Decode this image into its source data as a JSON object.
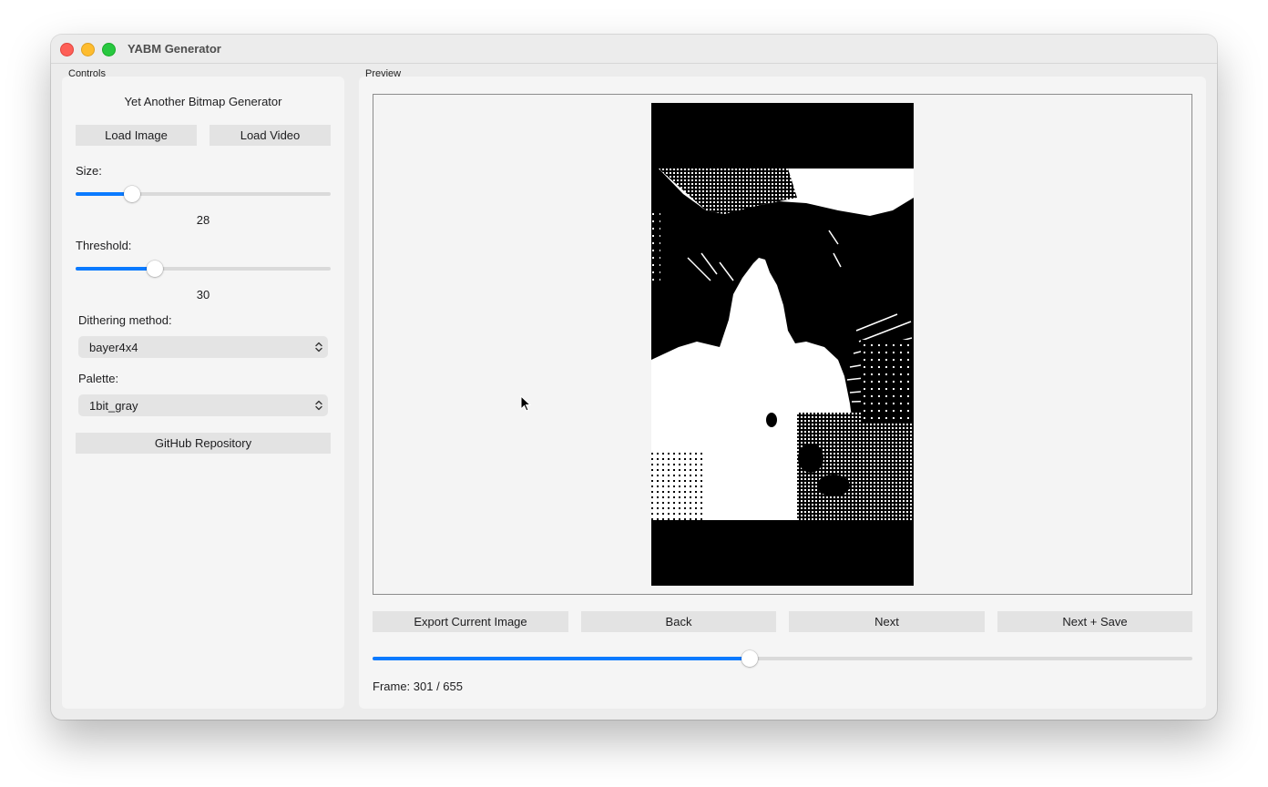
{
  "window": {
    "title": "YABM Generator"
  },
  "controls": {
    "group_label": "Controls",
    "heading": "Yet Another Bitmap Generator",
    "load_image_label": "Load Image",
    "load_video_label": "Load Video",
    "size": {
      "label": "Size:",
      "value": "28",
      "fraction": 0.22
    },
    "threshold": {
      "label": "Threshold:",
      "value": "30",
      "fraction": 0.31
    },
    "dithering": {
      "label": "Dithering method:",
      "selected": "bayer4x4",
      "icon": "updown-chevron-icon"
    },
    "palette": {
      "label": "Palette:",
      "selected": "1bit_gray",
      "icon": "updown-chevron-icon"
    },
    "github_label": "GitHub Repository"
  },
  "preview": {
    "group_label": "Preview",
    "export_label": "Export Current Image",
    "back_label": "Back",
    "next_label": "Next",
    "next_save_label": "Next + Save",
    "frame_fraction": 0.46,
    "frame_text": "Frame: 301 / 655"
  },
  "colors": {
    "accent": "#0a7aff"
  }
}
